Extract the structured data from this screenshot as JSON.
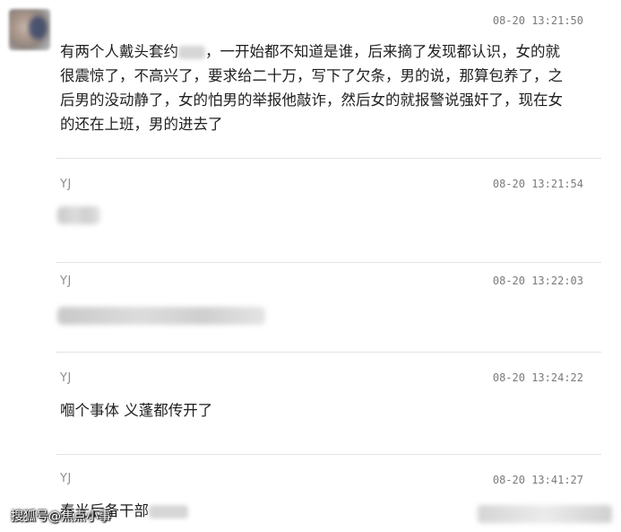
{
  "messages": [
    {
      "sender": "",
      "time": "08-20 13:21:50",
      "text_before_blur": "有两个人戴头套约",
      "text_after_blur": "，一开始都不知道是谁，后来摘了发现都认识，女的就很震惊了，不高兴了，要求给二十万，写下了欠条，男的说，那算包养了，之后男的没动静了，女的怕男的举报他敲诈，然后女的就报警说强奸了，现在女的还在上班，男的进去了"
    },
    {
      "sender": "YJ",
      "time": "08-20 13:21:54"
    },
    {
      "sender": "YJ",
      "time": "08-20 13:22:03"
    },
    {
      "sender": "YJ",
      "time": "08-20 13:24:22",
      "text": "嗰个事体 义蓬都传开了"
    },
    {
      "sender": "YJ",
      "time": "08-20 13:41:27",
      "text": "秦光后备干部"
    }
  ],
  "watermark": "搜狐号@焦点小事"
}
